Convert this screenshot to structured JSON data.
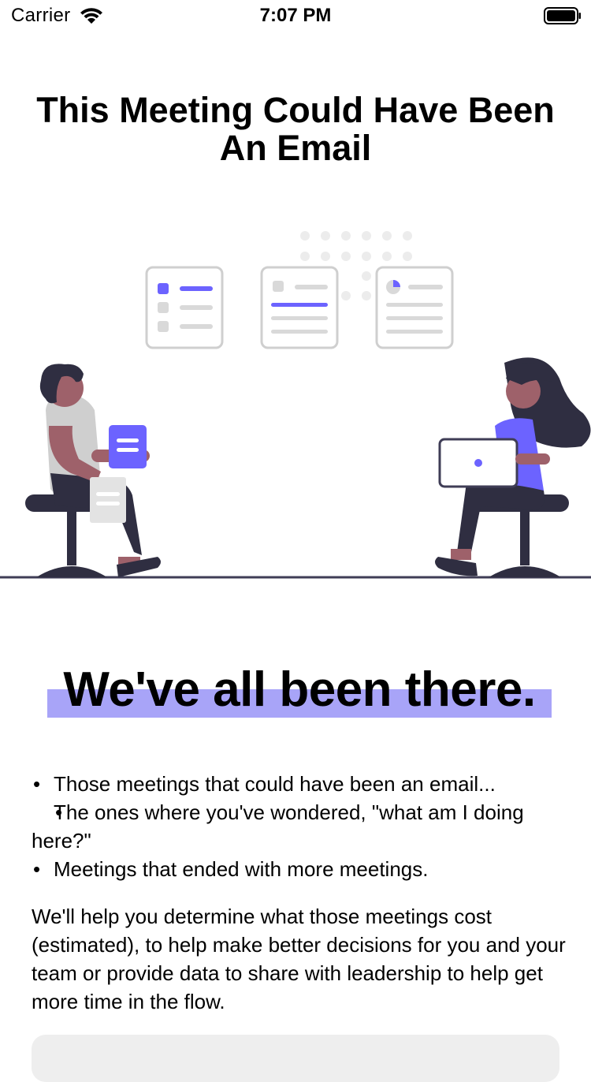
{
  "status_bar": {
    "carrier": "Carrier",
    "time": "7:07 PM",
    "wifi_icon": "wifi-icon",
    "battery_icon": "battery-icon"
  },
  "title": "This Meeting Could Have Been An Email",
  "illustration": {
    "icon": "meeting-illustration",
    "accent_color": "#6c63ff",
    "highlight_color": "#a8a4f8"
  },
  "headline": "We've all been there.",
  "bullets": [
    "Those meetings that could have been an email...",
    "The ones where you've wondered, \"what am I doing here?\"",
    "Meetings that ended with more meetings."
  ],
  "paragraph": "We'll help you determine what those meetings cost (estimated), to help make better decisions for you and your team or provide data to share with leadership to help get more time in the flow."
}
